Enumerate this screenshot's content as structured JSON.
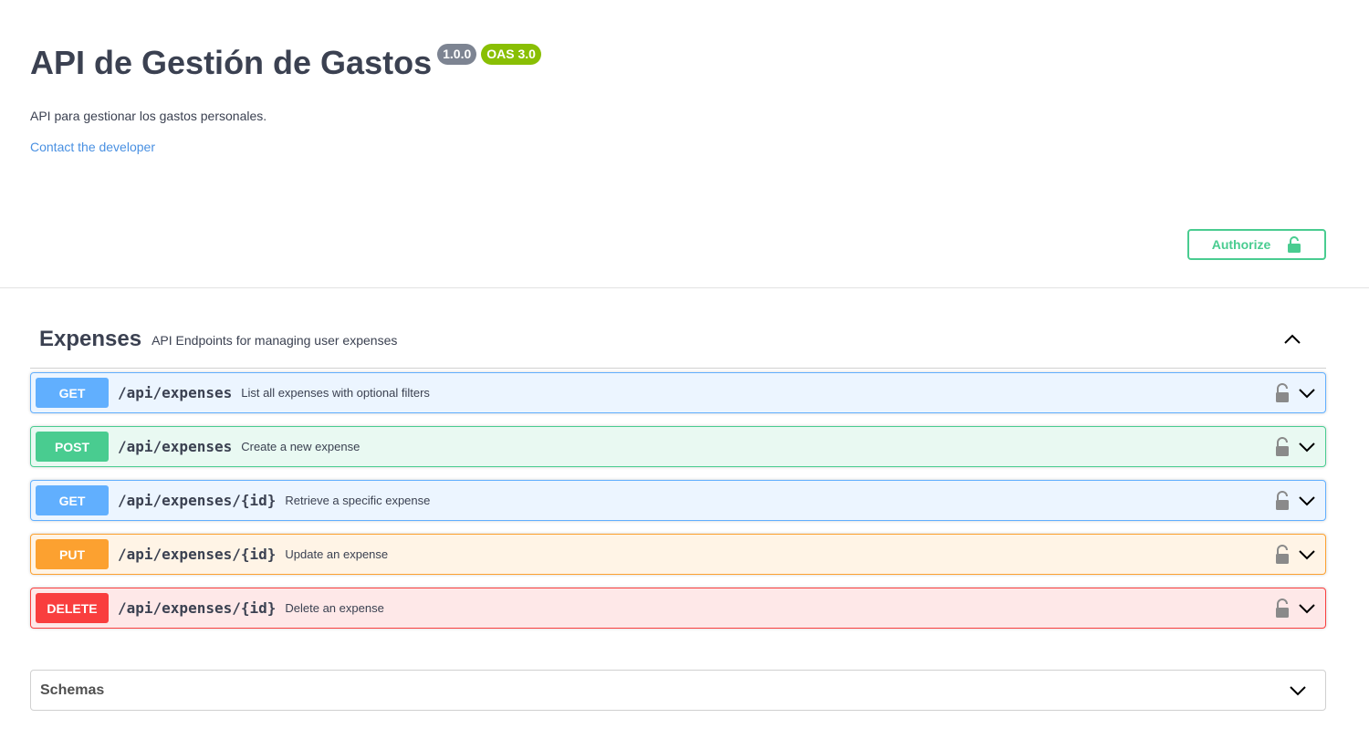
{
  "info": {
    "title": "API de Gestión de Gastos",
    "version_badge": "1.0.0",
    "oas_badge": "OAS 3.0",
    "description": "API para gestionar los gastos personales.",
    "contact_link": "Contact the developer"
  },
  "authorize": {
    "label": "Authorize",
    "icon": "unlock-icon"
  },
  "tag": {
    "name": "Expenses",
    "description": "API Endpoints for managing user expenses",
    "expanded": true
  },
  "operations": [
    {
      "method": "GET",
      "path": "/api/expenses",
      "summary": "List all expenses with optional filters"
    },
    {
      "method": "POST",
      "path": "/api/expenses",
      "summary": "Create a new expense"
    },
    {
      "method": "GET",
      "path": "/api/expenses/{id}",
      "summary": "Retrieve a specific expense"
    },
    {
      "method": "PUT",
      "path": "/api/expenses/{id}",
      "summary": "Update an expense"
    },
    {
      "method": "DELETE",
      "path": "/api/expenses/{id}",
      "summary": "Delete an expense"
    }
  ],
  "schemas": {
    "title": "Schemas"
  },
  "colors": {
    "get": "#61affe",
    "post": "#49cc90",
    "put": "#fca130",
    "delete": "#f93e3e",
    "version_badge": "#7d8492",
    "oas_badge": "#89bf04",
    "link": "#4990e2"
  }
}
